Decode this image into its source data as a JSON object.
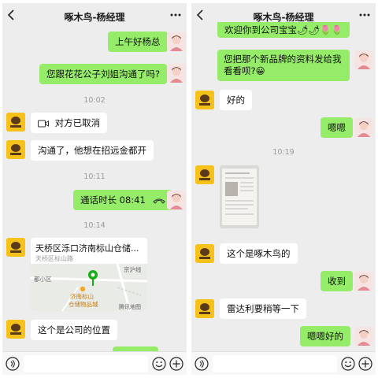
{
  "left": {
    "title": "啄木鸟-杨经理",
    "messages": {
      "m1": "上午好杨总",
      "m2": "您跟花花公子刘姐沟通了吗?",
      "t1": "10:02",
      "m3": "对方已取消",
      "m4": "沟通了，他想在招远金都开",
      "t2": "10:11",
      "m5": "通话时长 08:41",
      "t3": "10:14",
      "loc_title": "天桥区泺口济南标山仓储...",
      "loc_sub": "天桥区标山路",
      "map_l1": "都小区",
      "map_l2": "济南标山",
      "map_l3": "仓储物品城",
      "map_l4": "京沪线",
      "map_logo": "腾讯地图",
      "m6": "这个是公司的位置"
    }
  },
  "right": {
    "title": "啄木鸟-杨经理",
    "messages": {
      "r0": "欢迎你到公司宝宝🌶🌶🌷🌷",
      "r1": "您把那个新品牌的资料发给我看看呗?😀",
      "r2": "好的",
      "r3": "嗯嗯",
      "t1": "10:19",
      "r4": "这个是啄木鸟的",
      "r5": "收到",
      "r6": "雷达利要稍等一下",
      "r7": "嗯嗯好的"
    }
  },
  "icons": {
    "back": "back-arrow-icon",
    "more": "more-icon",
    "voice": "voice-input-icon",
    "emoji": "emoji-icon",
    "plus": "plus-icon",
    "video": "video-call-icon",
    "phone": "phone-hangup-icon",
    "pin": "map-pin-icon"
  },
  "colors": {
    "sent_bubble": "#95ec69",
    "received_bubble": "#ffffff",
    "background": "#ededed",
    "map_pin": "#1aad19"
  }
}
